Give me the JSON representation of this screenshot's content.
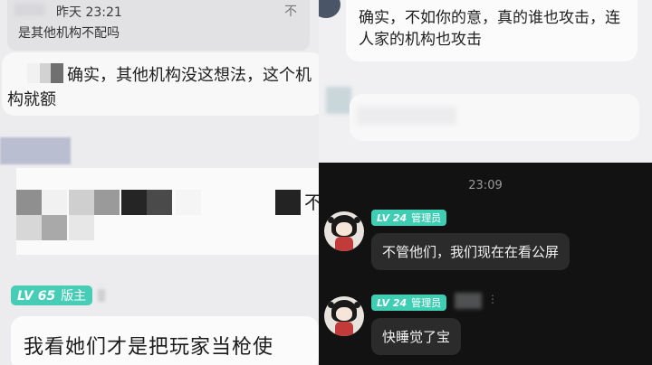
{
  "left_panel": {
    "quote": {
      "time": "昨天 23:21",
      "text": "是其他机构不配吗",
      "close_glyph": "不"
    },
    "reply": {
      "text": "确实，其他机构没这想法，这个机构就额"
    },
    "trailing_char": "不",
    "badge": {
      "level": "LV 65",
      "role": "版主"
    },
    "message": {
      "text": "我看她们才是把玩家当枪使"
    }
  },
  "right_top": {
    "bubble_text": "确实，不如你的意，真的谁也攻击，连人家的机构也攻击"
  },
  "right_dark": {
    "time_divider": "23:09",
    "messages": [
      {
        "level": "LV 24",
        "role": "管理员",
        "text": "不管他们，我们现在在看公屏"
      },
      {
        "level": "LV 24",
        "role": "管理员",
        "text": "快睡觉了宝",
        "more_glyph": "⋮"
      }
    ]
  },
  "colors": {
    "badge_teal": "#47cdb6",
    "dark_bg": "#121212",
    "dark_bubble": "#2b2b2b"
  }
}
